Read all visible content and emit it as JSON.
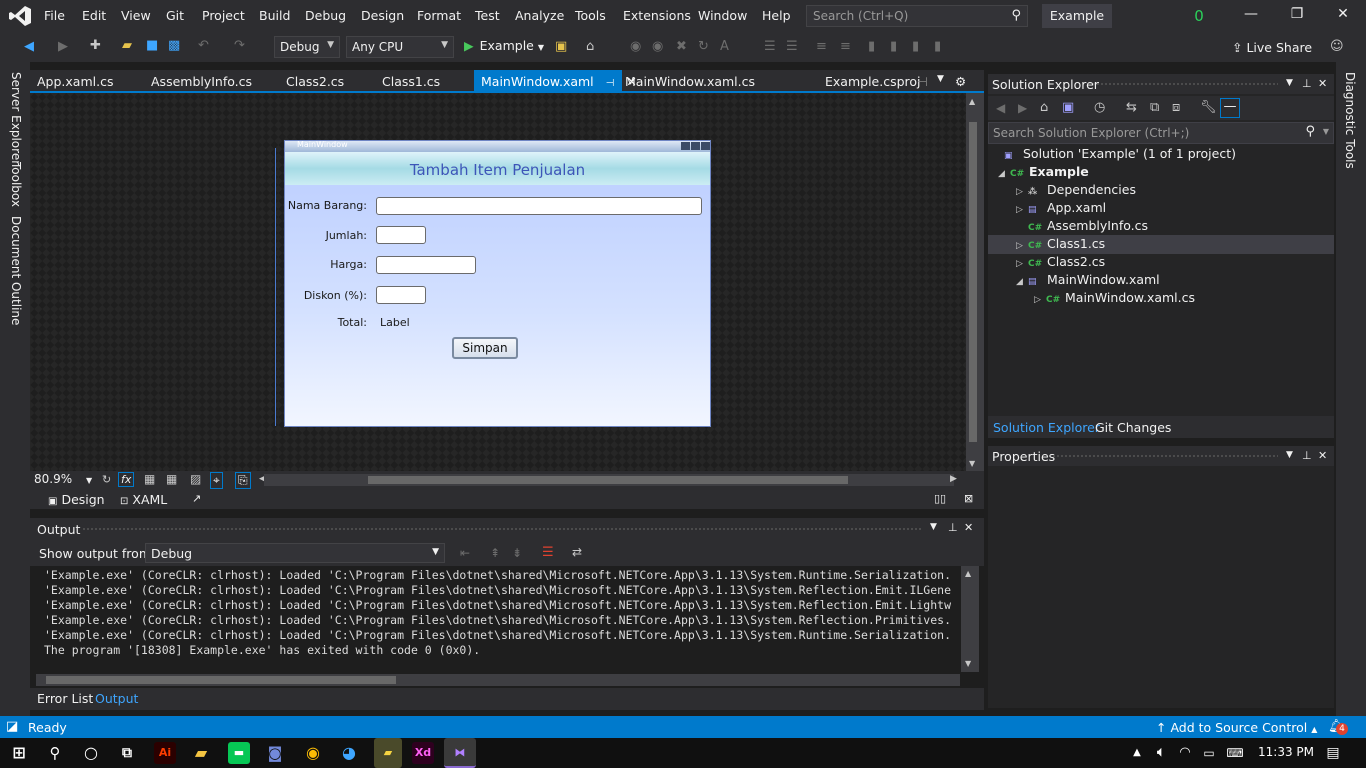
{
  "menu": {
    "items": [
      "File",
      "Edit",
      "View",
      "Git",
      "Project",
      "Build",
      "Debug",
      "Design",
      "Format",
      "Test",
      "Analyze",
      "Tools",
      "Extensions",
      "Window",
      "Help"
    ],
    "search_placeholder": "Search (Ctrl+Q)",
    "solution_name": "Example",
    "badge": "0"
  },
  "toolbar": {
    "config": "Debug",
    "platform": "Any CPU",
    "start_label": "Example",
    "live_share": "Live Share"
  },
  "side_tabs": {
    "left": [
      "Server Explorer",
      "Toolbox",
      "Document Outline"
    ],
    "right": [
      "Diagnostic Tools"
    ]
  },
  "doc_tabs": [
    {
      "label": "App.xaml.cs"
    },
    {
      "label": "AssemblyInfo.cs"
    },
    {
      "label": "Class2.cs"
    },
    {
      "label": "Class1.cs"
    },
    {
      "label": "MainWindow.xaml",
      "active": true
    },
    {
      "label": "MainWindow.xaml.cs"
    },
    {
      "label": "Example.csproj"
    }
  ],
  "designer": {
    "window_title": "MainWindow",
    "heading": "Tambah Item Penjualan",
    "labels": {
      "nama": "Nama Barang:",
      "jumlah": "Jumlah:",
      "harga": "Harga:",
      "diskon": "Diskon (%):",
      "total": "Total:",
      "total_value": "Label"
    },
    "button": "Simpan",
    "zoom": "80.9%",
    "view_tabs": [
      "Design",
      "XAML"
    ]
  },
  "output": {
    "title": "Output",
    "show_from_label": "Show output from:",
    "show_from_value": "Debug",
    "lines": [
      "'Example.exe' (CoreCLR: clrhost): Loaded 'C:\\Program Files\\dotnet\\shared\\Microsoft.NETCore.App\\3.1.13\\System.Runtime.Serialization.",
      "'Example.exe' (CoreCLR: clrhost): Loaded 'C:\\Program Files\\dotnet\\shared\\Microsoft.NETCore.App\\3.1.13\\System.Reflection.Emit.ILGene",
      "'Example.exe' (CoreCLR: clrhost): Loaded 'C:\\Program Files\\dotnet\\shared\\Microsoft.NETCore.App\\3.1.13\\System.Reflection.Emit.Lightw",
      "'Example.exe' (CoreCLR: clrhost): Loaded 'C:\\Program Files\\dotnet\\shared\\Microsoft.NETCore.App\\3.1.13\\System.Reflection.Primitives.",
      "'Example.exe' (CoreCLR: clrhost): Loaded 'C:\\Program Files\\dotnet\\shared\\Microsoft.NETCore.App\\3.1.13\\System.Runtime.Serialization.",
      "The program '[18308] Example.exe' has exited with code 0 (0x0)."
    ],
    "bottom_tabs": [
      "Error List",
      "Output"
    ]
  },
  "solution_explorer": {
    "title": "Solution Explorer",
    "search_placeholder": "Search Solution Explorer (Ctrl+;)",
    "tree": [
      {
        "label": "Solution 'Example' (1 of 1 project)",
        "icon": "solution-icon"
      },
      {
        "label": "Example",
        "icon": "csharp-project-icon"
      },
      {
        "label": "Dependencies",
        "icon": "dependencies-icon"
      },
      {
        "label": "App.xaml",
        "icon": "xaml-file-icon"
      },
      {
        "label": "AssemblyInfo.cs",
        "icon": "csharp-file-icon"
      },
      {
        "label": "Class1.cs",
        "icon": "csharp-file-icon",
        "selected": true
      },
      {
        "label": "Class2.cs",
        "icon": "csharp-file-icon"
      },
      {
        "label": "MainWindow.xaml",
        "icon": "xaml-file-icon"
      },
      {
        "label": "MainWindow.xaml.cs",
        "icon": "csharp-file-icon"
      }
    ],
    "tabs": [
      "Solution Explorer",
      "Git Changes"
    ]
  },
  "properties": {
    "title": "Properties"
  },
  "status": {
    "ready": "Ready",
    "source_control": "Add to Source Control",
    "notifications": "4"
  },
  "taskbar": {
    "time": "11:33 PM"
  },
  "colors": {
    "accent": "#007acc",
    "background": "#1e1e1e",
    "chrome": "#2d2d30"
  }
}
